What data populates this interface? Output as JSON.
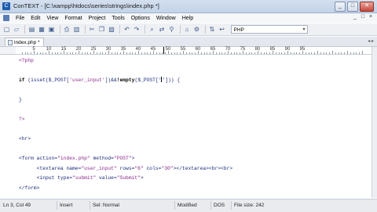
{
  "window": {
    "title": "ConTEXT - [C:\\xampp\\htdocs\\series\\strings\\index.php *]",
    "app_icon_letter": "C",
    "minimize": "_",
    "maximize": "□",
    "close": "✕"
  },
  "menu": {
    "items": [
      "File",
      "Edit",
      "View",
      "Format",
      "Project",
      "Tools",
      "Options",
      "Window",
      "Help"
    ],
    "doc_controls": [
      "_",
      "□",
      "×"
    ]
  },
  "toolbar": {
    "icons": [
      "new-file-icon",
      "open-icon",
      "save-icon",
      "save-all-icon",
      "close-file-icon",
      "print-icon",
      "print-preview-icon",
      "cut-icon",
      "copy-icon",
      "paste-icon",
      "undo-icon",
      "redo-icon",
      "find-icon",
      "find-replace-icon",
      "search-in-files-icon",
      "bookmark-icon",
      "options-icon",
      "sort-icon",
      "word-wrap-icon"
    ],
    "glyphs": [
      "▢",
      "▱",
      "▤",
      "▦",
      "▣",
      "⎙",
      "▥",
      "✂",
      "❐",
      "▧",
      "↶",
      "↷",
      "⌕",
      "⇄",
      "⚲",
      "⌂",
      "⚙",
      "⇅",
      "↩"
    ],
    "highlighter_label": "PHP",
    "highlighter_arrow": "▾"
  },
  "tabs": [
    {
      "label": "index.php *"
    }
  ],
  "tab_arrows": "◂ ▸",
  "ruler": {
    "labels": [
      "5",
      "10",
      "15",
      "20",
      "25",
      "30",
      "35",
      "40",
      "45",
      "50",
      "55",
      "60",
      "65",
      "70",
      "75",
      "80",
      "85",
      "90",
      "95"
    ]
  },
  "editor": {
    "lines": [
      {
        "segments": [
          {
            "t": "<?php",
            "c": "str"
          }
        ]
      },
      {
        "segments": []
      },
      {
        "segments": [
          {
            "t": "if",
            "c": "kw"
          },
          {
            "t": " (isset(",
            "c": "var"
          },
          {
            "t": "$_POST",
            "c": "var"
          },
          {
            "t": "[",
            "c": "var"
          },
          {
            "t": "'user_input'",
            "c": "str"
          },
          {
            "t": "])&&",
            "c": "var"
          },
          {
            "t": "!",
            "c": "kw"
          },
          {
            "t": "empty",
            "c": "kw"
          },
          {
            "t": "(",
            "c": "var"
          },
          {
            "t": "$_POST",
            "c": "var"
          },
          {
            "t": "['",
            "c": "var"
          },
          {
            "t": "CARET",
            "c": "caret"
          },
          {
            "t": "'])) {",
            "c": "var"
          }
        ]
      },
      {
        "segments": []
      },
      {
        "segments": [
          {
            "t": "}",
            "c": "var"
          }
        ]
      },
      {
        "segments": []
      },
      {
        "segments": [
          {
            "t": "?>",
            "c": "str"
          }
        ]
      },
      {
        "segments": []
      },
      {
        "segments": [
          {
            "t": "<hr>",
            "c": "var"
          }
        ]
      },
      {
        "segments": []
      },
      {
        "segments": [
          {
            "t": "<form action=",
            "c": "var"
          },
          {
            "t": "\"index.php\"",
            "c": "str"
          },
          {
            "t": " method=",
            "c": "var"
          },
          {
            "t": "\"POST\"",
            "c": "str"
          },
          {
            "t": ">",
            "c": "var"
          }
        ]
      },
      {
        "segments": [
          {
            "t": "      <textarea name=",
            "c": "var"
          },
          {
            "t": "\"user_input\"",
            "c": "str"
          },
          {
            "t": " rows=",
            "c": "var"
          },
          {
            "t": "\"6\"",
            "c": "str"
          },
          {
            "t": " cols=",
            "c": "var"
          },
          {
            "t": "\"30\"",
            "c": "str"
          },
          {
            "t": "></textarea><br><br>",
            "c": "var"
          }
        ]
      },
      {
        "segments": [
          {
            "t": "      <input type=",
            "c": "var"
          },
          {
            "t": "\"submit\"",
            "c": "str"
          },
          {
            "t": " value=",
            "c": "var"
          },
          {
            "t": "\"Submit\"",
            "c": "str"
          },
          {
            "t": ">",
            "c": "var"
          }
        ]
      },
      {
        "segments": [
          {
            "t": "</form>",
            "c": "var"
          }
        ]
      }
    ]
  },
  "status": {
    "position": "Ln 3, Col 49",
    "mode": "Insert",
    "sel": "Sel: Normal",
    "modified": "Modified",
    "format": "DOS",
    "file_size": "File size: 242"
  }
}
